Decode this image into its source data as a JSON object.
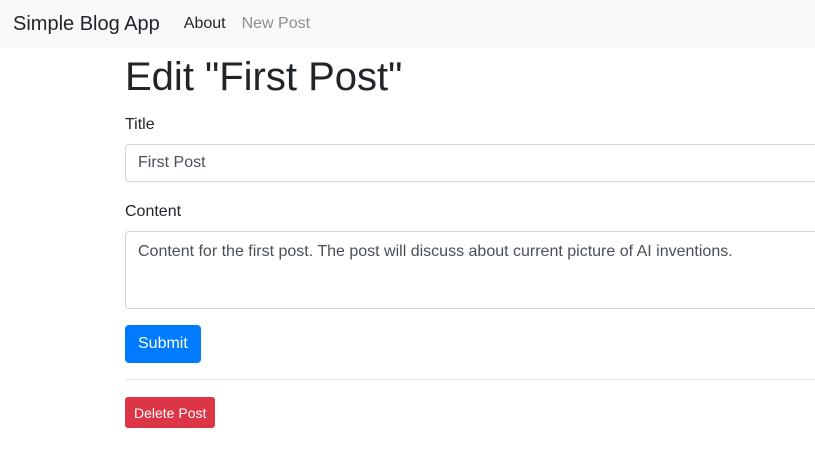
{
  "navbar": {
    "brand": "Simple Blog App",
    "links": [
      {
        "label": "About"
      },
      {
        "label": "New Post"
      }
    ]
  },
  "page": {
    "heading": "Edit \"First Post\""
  },
  "form": {
    "title_label": "Title",
    "title_value": "First Post",
    "content_label": "Content",
    "content_value": "Content for the first post. The post will discuss about current picture of AI inventions.",
    "submit_label": "Submit"
  },
  "actions": {
    "delete_label": "Delete Post"
  },
  "colors": {
    "primary": "#007bff",
    "danger": "#dc3545",
    "navbar_bg": "#f8f9fa"
  }
}
